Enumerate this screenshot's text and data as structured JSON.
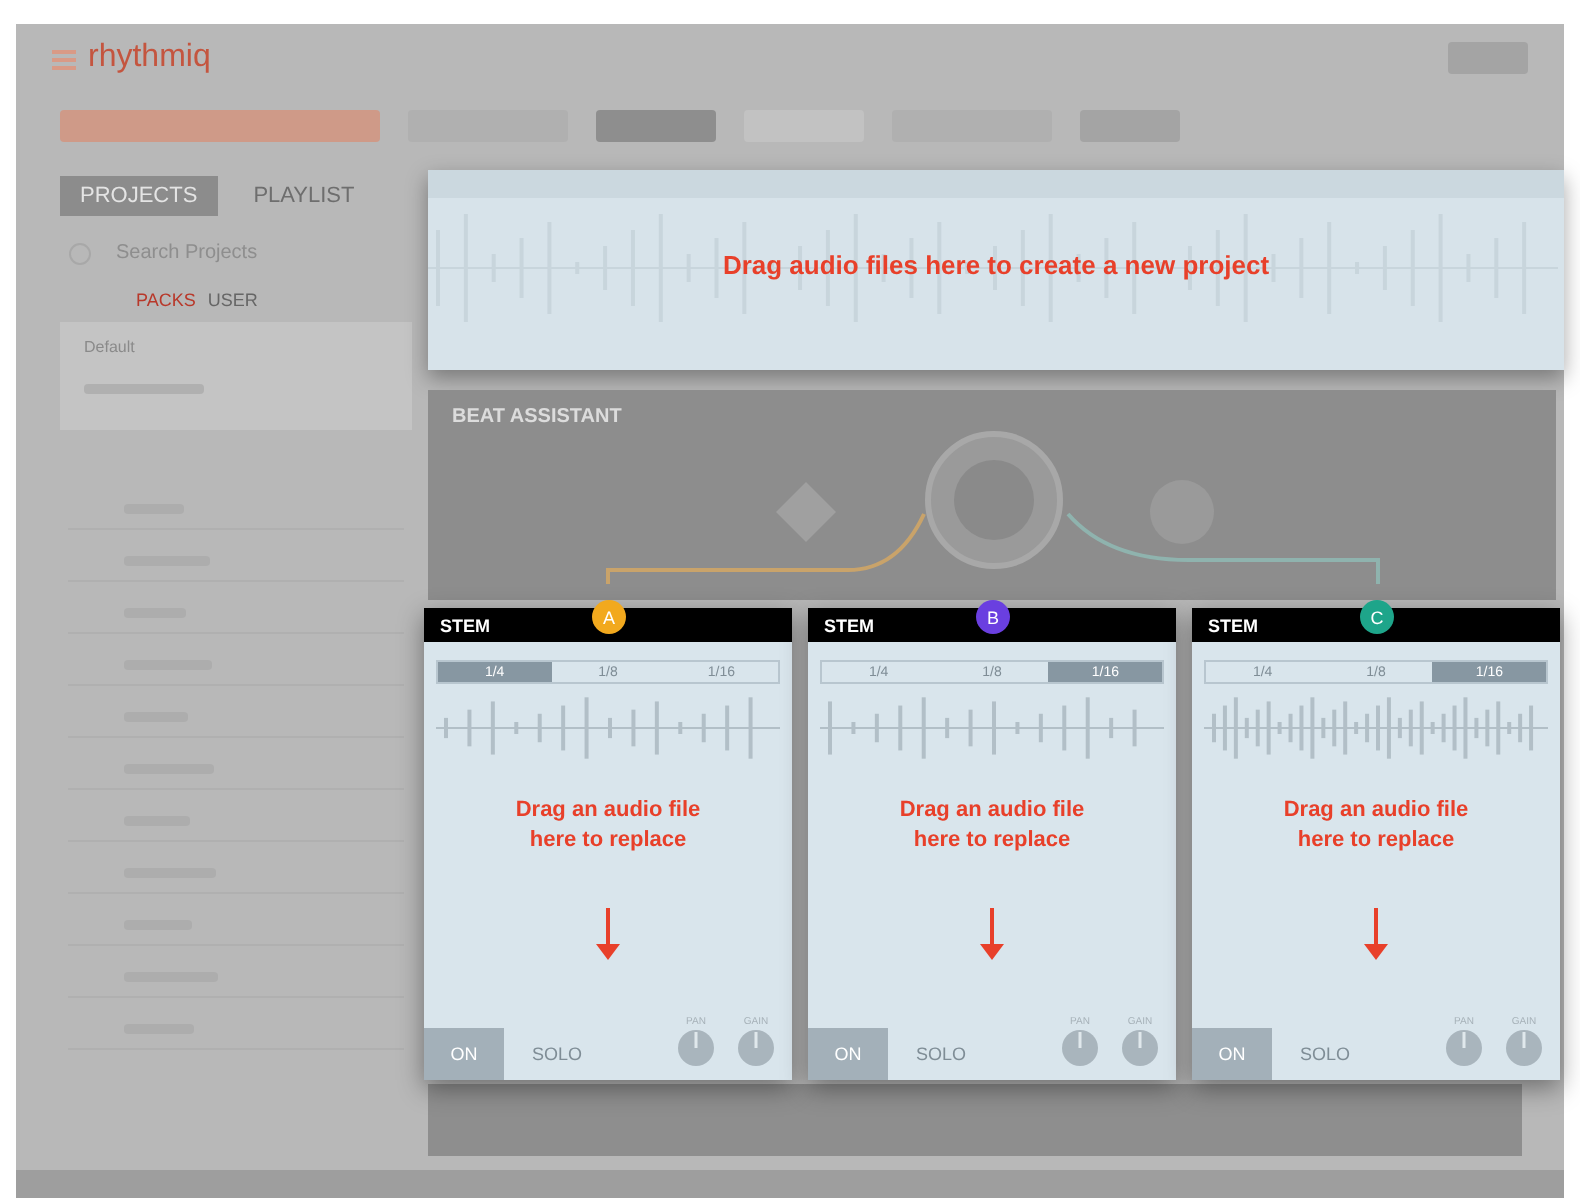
{
  "app": {
    "logo": "rhythmiq"
  },
  "sidebar": {
    "tabs": [
      {
        "label": "PROJECTS",
        "selected": true
      },
      {
        "label": "PLAYLIST",
        "selected": false
      }
    ],
    "search": {
      "placeholder": "Search Projects"
    },
    "filters": [
      {
        "label": "PACKS",
        "selected": true
      },
      {
        "label": "USER",
        "selected": false
      }
    ],
    "folder": "Default"
  },
  "drop_zone": {
    "message": "Drag audio files here to create a new project"
  },
  "beat_assistant": {
    "title": "BEAT ASSISTANT"
  },
  "stems": [
    {
      "title": "STEM",
      "badge": "A",
      "color": "#f2a91e",
      "divisions": [
        {
          "label": "1/4",
          "selected": true
        },
        {
          "label": "1/8",
          "selected": false
        },
        {
          "label": "1/16",
          "selected": false
        }
      ],
      "message": "Drag an audio file here to replace",
      "on": true,
      "on_label": "ON",
      "solo_label": "SOLO",
      "knobs": [
        "PAN",
        "GAIN"
      ]
    },
    {
      "title": "STEM",
      "badge": "B",
      "color": "#6a3fe0",
      "divisions": [
        {
          "label": "1/4",
          "selected": false
        },
        {
          "label": "1/8",
          "selected": false
        },
        {
          "label": "1/16",
          "selected": true
        }
      ],
      "message": "Drag an audio file here to replace",
      "on": true,
      "on_label": "ON",
      "solo_label": "SOLO",
      "knobs": [
        "PAN",
        "GAIN"
      ]
    },
    {
      "title": "STEM",
      "badge": "C",
      "color": "#1ea58a",
      "divisions": [
        {
          "label": "1/4",
          "selected": false
        },
        {
          "label": "1/8",
          "selected": false
        },
        {
          "label": "1/16",
          "selected": true
        }
      ],
      "message": "Drag an audio file here to replace",
      "on": true,
      "on_label": "ON",
      "solo_label": "SOLO",
      "knobs": [
        "PAN",
        "GAIN"
      ]
    }
  ]
}
